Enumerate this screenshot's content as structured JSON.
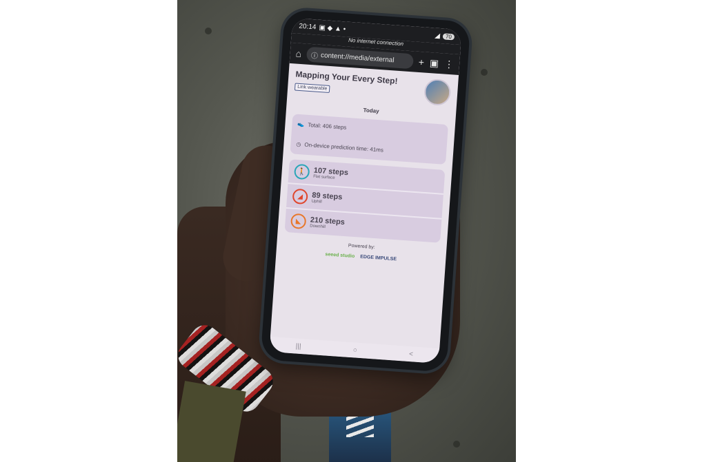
{
  "status_bar": {
    "time": "20:14",
    "battery": "70"
  },
  "no_internet": "No internet connection",
  "browser": {
    "url": "content://media/external",
    "home_icon": "home-icon",
    "info_icon": "info-icon",
    "plus_icon": "plus-icon",
    "tabs_icon": "tabs-icon",
    "menu_icon": "kebab-menu-icon"
  },
  "app": {
    "title": "Mapping Your Every Step!",
    "link_wearable": "Link wearable",
    "today": "Today",
    "total": "Total: 406 steps",
    "prediction_time": "On-device prediction time: 41ms",
    "stats": [
      {
        "count": "107 steps",
        "label": "Flat surface",
        "color": "#2aa6b8",
        "icon": "walk-icon"
      },
      {
        "count": "89 steps",
        "label": "Uphill",
        "color": "#e0452b",
        "icon": "uphill-icon"
      },
      {
        "count": "210 steps",
        "label": "Downhill",
        "color": "#e8772a",
        "icon": "downhill-icon"
      }
    ],
    "powered_by": "Powered by:",
    "logo1": "seeed studio",
    "logo2": "EDGE IMPULSE"
  },
  "nav": {
    "recent": "|||",
    "home": "○",
    "back": "<"
  }
}
